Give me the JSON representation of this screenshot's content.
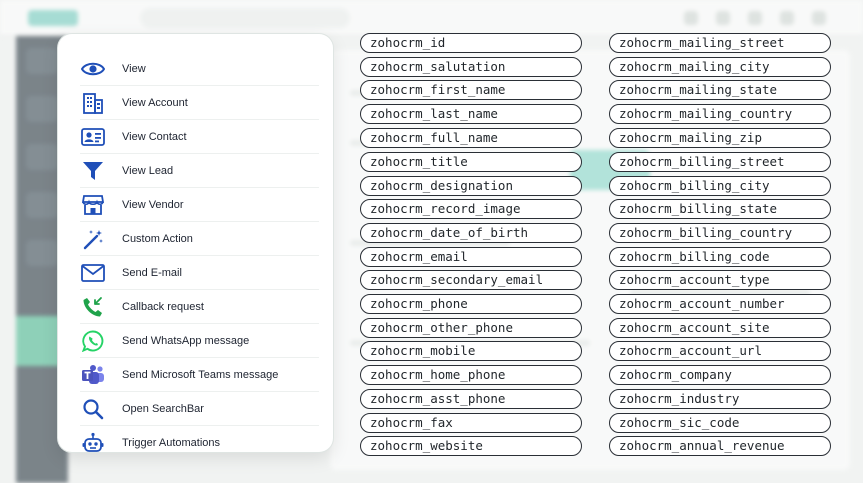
{
  "menu": {
    "items": [
      {
        "label": "View",
        "icon": "eye-icon"
      },
      {
        "label": "View Account",
        "icon": "building-icon"
      },
      {
        "label": "View Contact",
        "icon": "contact-card-icon"
      },
      {
        "label": "View Lead",
        "icon": "funnel-icon"
      },
      {
        "label": "View Vendor",
        "icon": "storefront-icon"
      },
      {
        "label": "Custom Action",
        "icon": "magic-wand-icon"
      },
      {
        "label": "Send E-mail",
        "icon": "envelope-icon"
      },
      {
        "label": "Callback request",
        "icon": "phone-callback-icon"
      },
      {
        "label": "Send WhatsApp message",
        "icon": "whatsapp-icon"
      },
      {
        "label": "Send Microsoft Teams message",
        "icon": "teams-icon"
      },
      {
        "label": "Open SearchBar",
        "icon": "search-icon"
      },
      {
        "label": "Trigger Automations",
        "icon": "robot-icon"
      }
    ]
  },
  "fields_left": [
    "zohocrm_id",
    "zohocrm_salutation",
    "zohocrm_first_name",
    "zohocrm_last_name",
    "zohocrm_full_name",
    "zohocrm_title",
    "zohocrm_designation",
    "zohocrm_record_image",
    "zohocrm_date_of_birth",
    "zohocrm_email",
    "zohocrm_secondary_email",
    "zohocrm_phone",
    "zohocrm_other_phone",
    "zohocrm_mobile",
    "zohocrm_home_phone",
    "zohocrm_asst_phone",
    "zohocrm_fax",
    "zohocrm_website"
  ],
  "fields_right": [
    "zohocrm_mailing_street",
    "zohocrm_mailing_city",
    "zohocrm_mailing_state",
    "zohocrm_mailing_country",
    "zohocrm_mailing_zip",
    "zohocrm_billing_street",
    "zohocrm_billing_city",
    "zohocrm_billing_state",
    "zohocrm_billing_country",
    "zohocrm_billing_code",
    "zohocrm_account_type",
    "zohocrm_account_number",
    "zohocrm_account_site",
    "zohocrm_account_url",
    "zohocrm_company",
    "zohocrm_industry",
    "zohocrm_sic_code",
    "zohocrm_annual_revenue"
  ],
  "colors": {
    "icon_blue": "#1f4fb8",
    "whatsapp_green": "#25d366",
    "teams_purple": "#5059c9",
    "pill_border": "#2a2f36"
  }
}
